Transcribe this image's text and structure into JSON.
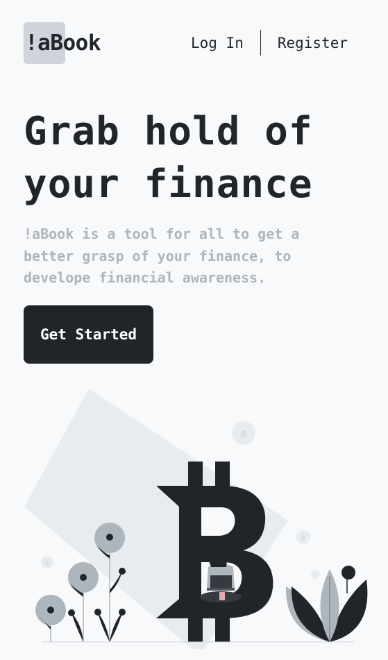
{
  "header": {
    "logo_text": "!aBook",
    "nav": {
      "login_label": "Log In",
      "register_label": "Register"
    }
  },
  "hero": {
    "title_line1": "Grab hold of",
    "title_line2": "your finance",
    "subtitle_line1": "!aBook is a tool for all to get a",
    "subtitle_line2": "better grasp of your finance, to",
    "subtitle_line3": "develope financial awareness.",
    "cta_label": "Get Started"
  },
  "illustration": {
    "coin_symbol": "฿",
    "icons": [
      "bitcoin-symbol-icon",
      "person-with-laptop-icon",
      "flower-plant-icon",
      "leaf-plant-icon",
      "coin-icon"
    ]
  },
  "colors": {
    "background": "#f8f9fa",
    "primary_dark": "#212529",
    "muted_text": "#adb5bd",
    "logo_box": "#ced4da",
    "accent_pink": "#e8a7b0"
  }
}
